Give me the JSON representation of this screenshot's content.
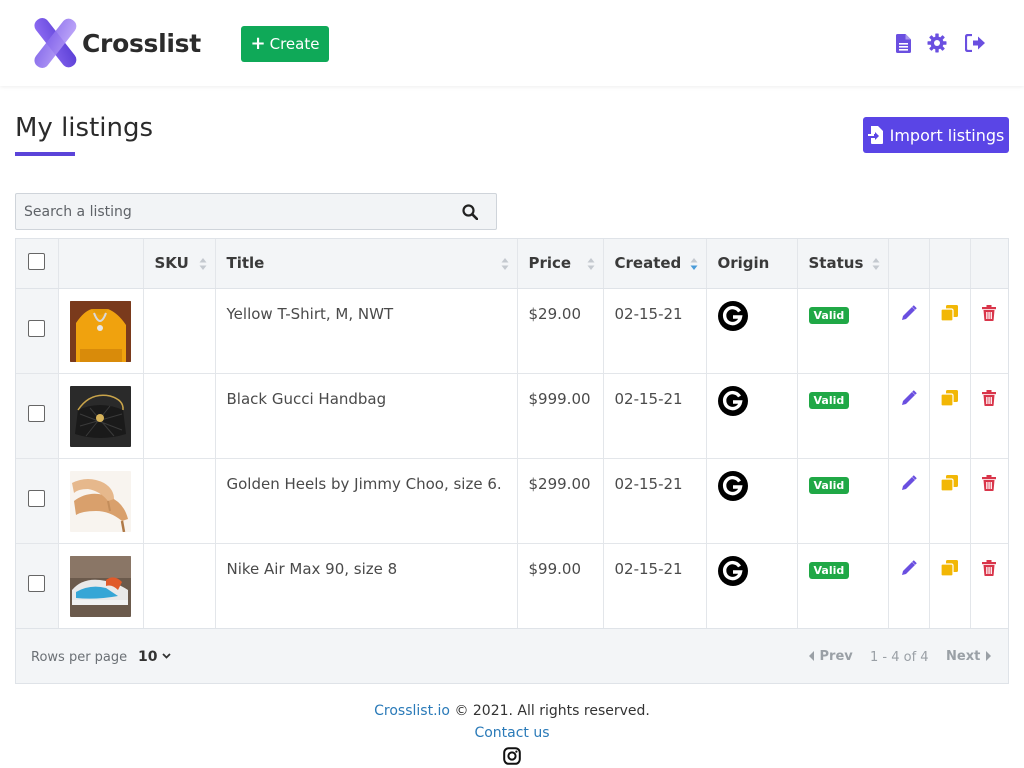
{
  "app": {
    "name": "Crosslist"
  },
  "header": {
    "create_label": "Create",
    "icons": [
      "document-icon",
      "gear-icon",
      "logout-icon"
    ]
  },
  "page": {
    "title": "My listings",
    "import_label": "Import listings"
  },
  "search": {
    "placeholder": "Search a listing"
  },
  "table": {
    "columns": [
      "SKU",
      "Title",
      "Price",
      "Created",
      "Origin",
      "Status"
    ],
    "rows": [
      {
        "sku": "",
        "title": "Yellow T-Shirt, M, NWT",
        "price": "$29.00",
        "created": "02-15-21",
        "origin": "G",
        "status": "Valid",
        "image": "yellow-tshirt"
      },
      {
        "sku": "",
        "title": "Black Gucci Handbag",
        "price": "$999.00",
        "created": "02-15-21",
        "origin": "G",
        "status": "Valid",
        "image": "black-handbag"
      },
      {
        "sku": "",
        "title": "Golden Heels by Jimmy Choo, size 6.",
        "price": "$299.00",
        "created": "02-15-21",
        "origin": "G",
        "status": "Valid",
        "image": "golden-heels"
      },
      {
        "sku": "",
        "title": "Nike Air Max 90, size 8",
        "price": "$99.00",
        "created": "02-15-21",
        "origin": "G",
        "status": "Valid",
        "image": "nike-sneaker"
      }
    ],
    "footer": {
      "rows_per_page_label": "Rows per page",
      "rows_per_page_value": "10",
      "prev_label": "Prev",
      "range": "1 - 4 of 4",
      "next_label": "Next"
    }
  },
  "footer": {
    "brand_link": "Crosslist.io",
    "copyright": "© 2021. All rights reserved.",
    "contact": "Contact us"
  },
  "colors": {
    "accent": "#5a45e6",
    "create_green": "#0fa958",
    "valid_green": "#20a846",
    "edit_purple": "#6a4fe0",
    "copy_yellow": "#f2b705",
    "delete_red": "#d9354a"
  }
}
